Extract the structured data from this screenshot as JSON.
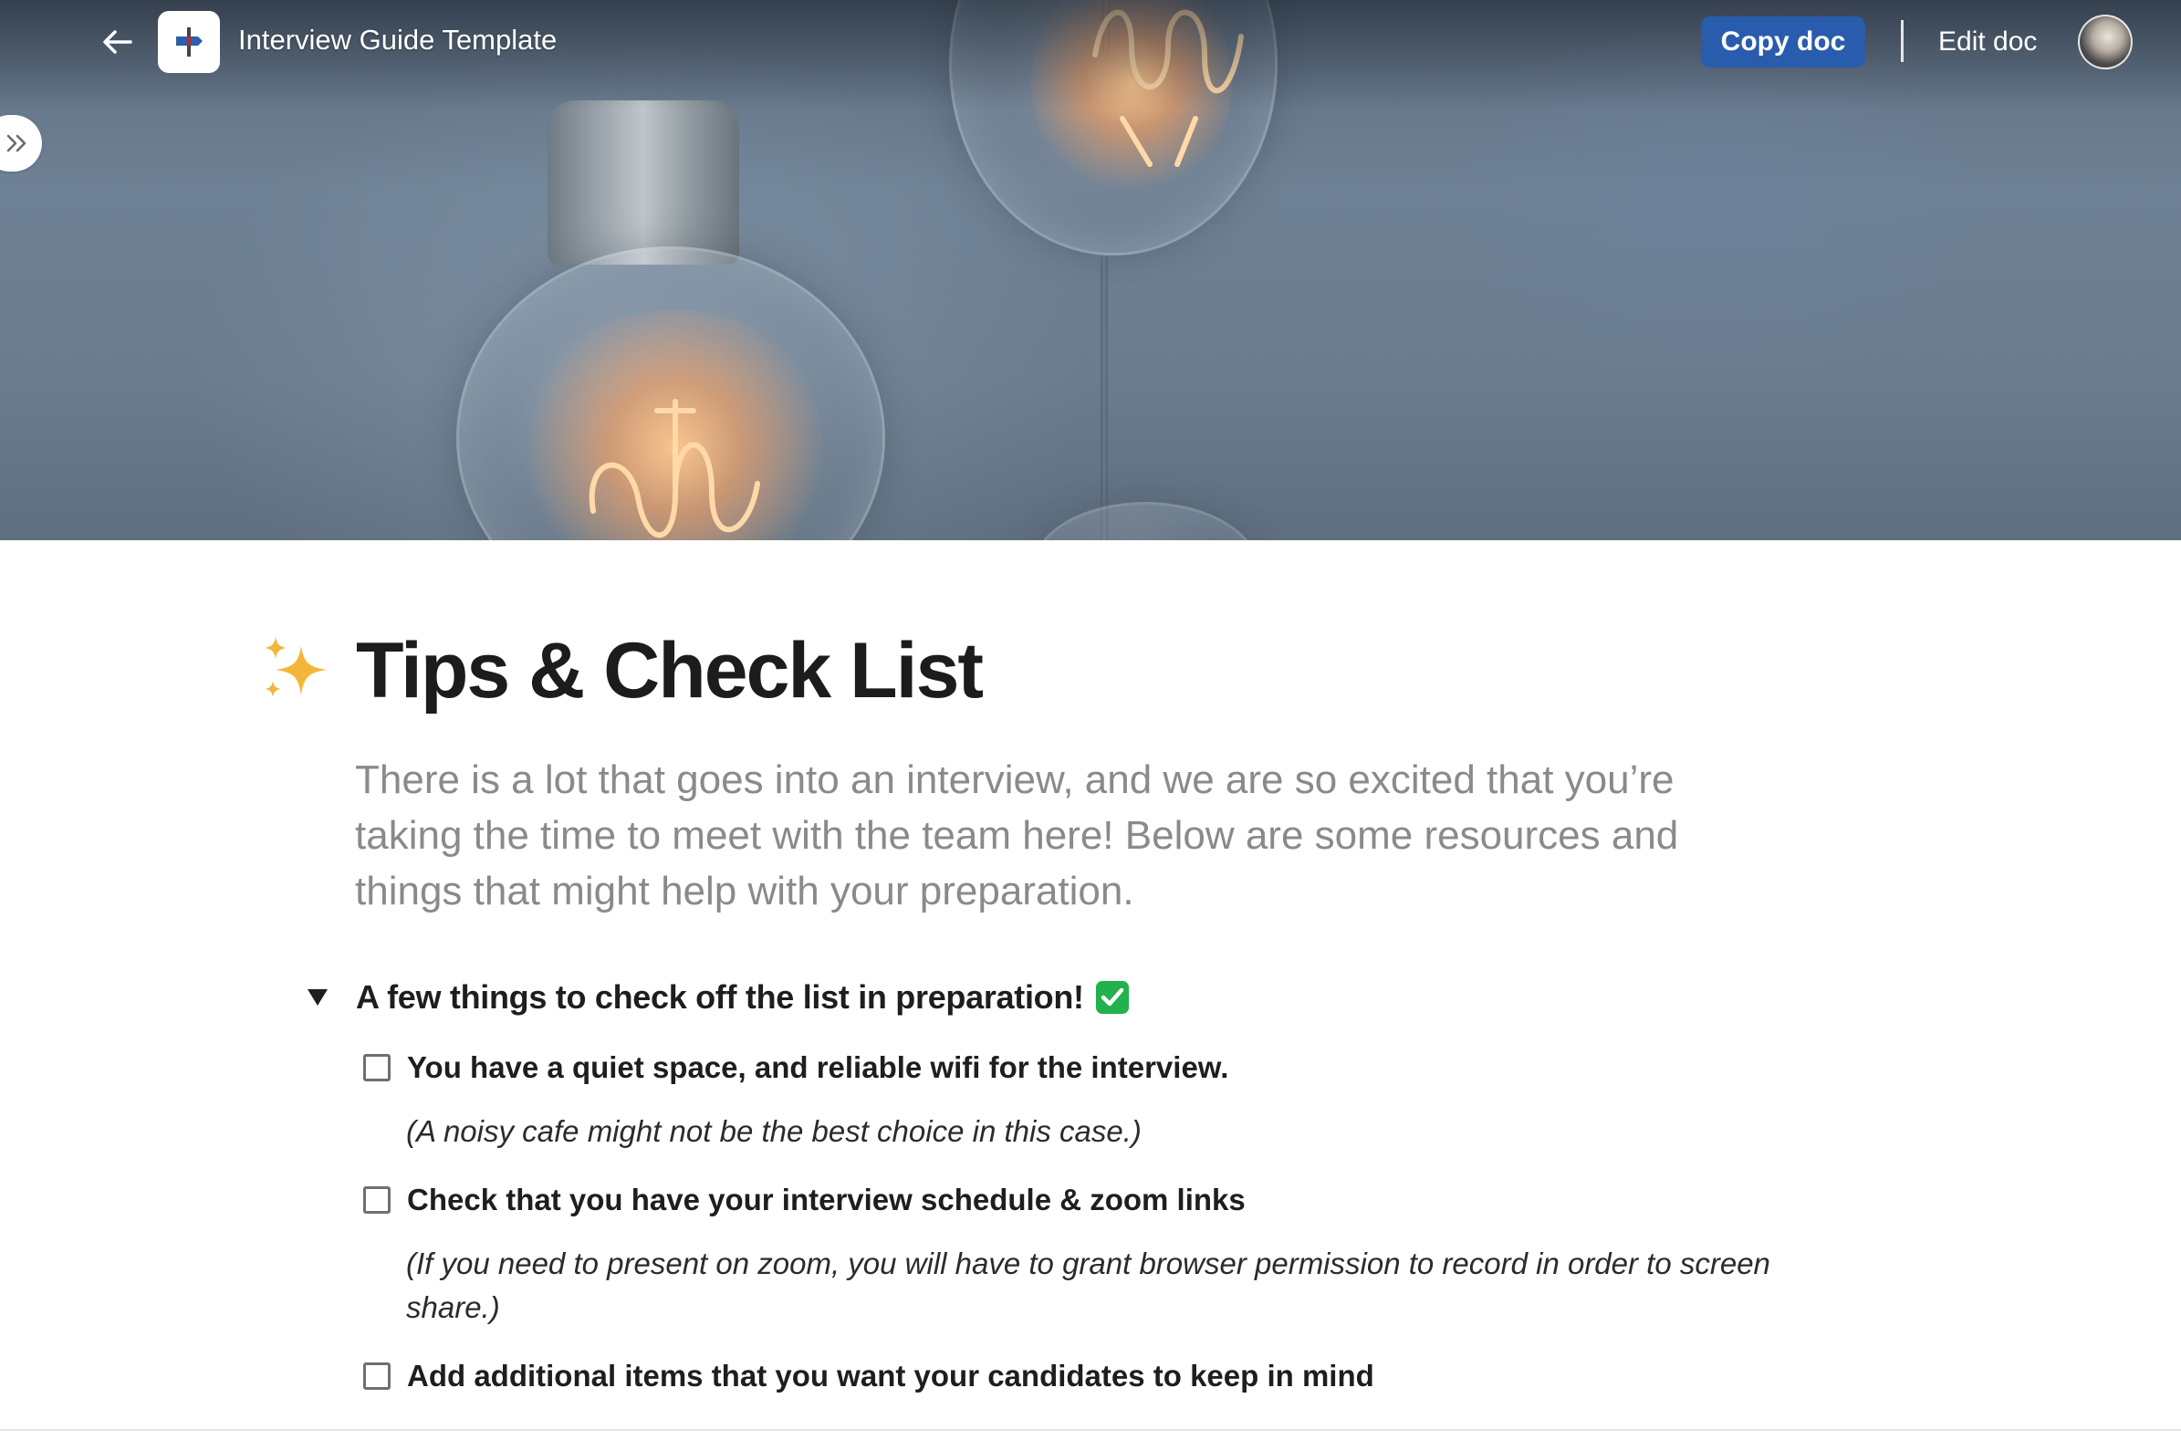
{
  "header": {
    "doc_title": "Interview Guide Template",
    "copy_label": "Copy doc",
    "edit_label": "Edit doc"
  },
  "page": {
    "title": "Tips & Check List",
    "intro": "There is a lot that goes into an interview, and we are so excited that you’re taking the time to meet with the team here! Below are some resources and things that might help with your preparation."
  },
  "checklist": {
    "toggle_title": "A few things to check off the list in preparation!",
    "items": [
      {
        "label": "You have a quiet space, and reliable wifi for the interview.",
        "note": "(A noisy cafe might not be the best choice in this case.)",
        "checked": false
      },
      {
        "label": "Check that you have your interview schedule & zoom links",
        "note": "(If you need to present on zoom, you will have to grant browser permission to record in order to screen share.)",
        "checked": false
      },
      {
        "label": "Add additional items that you want your candidates to keep in mind",
        "checked": false
      }
    ]
  },
  "icons": {
    "back": "arrow-left-icon",
    "logo": "signpost-icon",
    "expand": "double-chevron-right-icon",
    "title_emoji": "sparkles-icon",
    "toggle": "triangle-down-icon",
    "toggle_emoji": "check-mark-button-icon"
  },
  "colors": {
    "accent": "#2a5cad",
    "intro_text": "#8a8a8a",
    "check_green": "#22b14c"
  }
}
